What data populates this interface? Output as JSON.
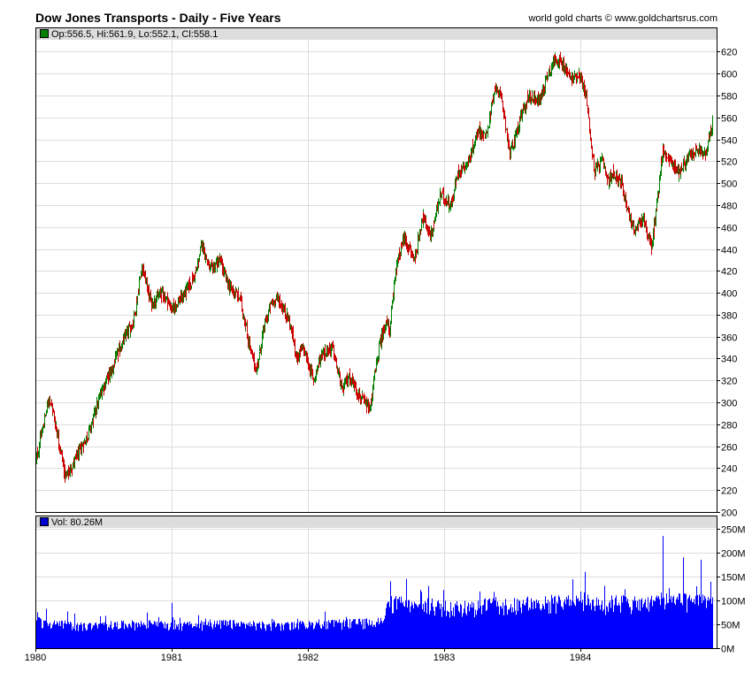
{
  "header": {
    "title": "Dow Jones Transports - Daily - Five Years",
    "credit": "world gold charts © www.goldchartsrus.com"
  },
  "price_legend": {
    "text": "Op:556.5, Hi:561.9, Lo:552.1, Cl:558.1",
    "color": "#008000"
  },
  "volume_legend": {
    "text": "Vol: 80.26M",
    "color": "#0000cc"
  },
  "colors": {
    "up": "#008000",
    "down": "#cc0000",
    "volume": "#0000ff",
    "grid": "#dcdcdc",
    "legend_bg": "#dddddd"
  },
  "chart_data": [
    {
      "type": "line",
      "title": "Dow Jones Transports - Daily - Five Years",
      "x_ticks": [
        "1980",
        "1981",
        "1982",
        "1983",
        "1984"
      ],
      "xlim": [
        1980.0,
        1985.0
      ],
      "ylim": [
        200,
        630
      ],
      "y_ticks": [
        200,
        220,
        240,
        260,
        280,
        300,
        320,
        340,
        360,
        380,
        400,
        420,
        440,
        460,
        480,
        500,
        520,
        540,
        560,
        580,
        600,
        620
      ],
      "last_bar": {
        "open": 556.5,
        "high": 561.9,
        "low": 552.1,
        "close": 558.1
      },
      "series": [
        {
          "x": [
            1980.0,
            1980.1,
            1980.13,
            1980.22,
            1980.26,
            1980.32,
            1980.4,
            1980.48,
            1980.56,
            1980.62,
            1980.72,
            1980.78,
            1980.85,
            1980.93,
            1981.0,
            1981.1,
            1981.18,
            1981.22,
            1981.28,
            1981.35,
            1981.42,
            1981.5,
            1981.58,
            1981.62,
            1981.68,
            1981.73,
            1981.78,
            1981.86,
            1981.92,
            1981.96,
            1982.04,
            1982.1,
            1982.18,
            1982.25,
            1982.3,
            1982.38,
            1982.45,
            1982.52,
            1982.57,
            1982.6,
            1982.64,
            1982.7,
            1982.78,
            1982.84,
            1982.9,
            1982.97,
            1983.05,
            1983.1,
            1983.18,
            1983.25,
            1983.3,
            1983.38,
            1983.43,
            1983.48,
            1983.56,
            1983.62,
            1983.7,
            1983.76,
            1983.82,
            1983.88,
            1983.93,
            1983.99,
            1984.04,
            1984.1,
            1984.16,
            1984.2,
            1984.24,
            1984.3,
            1984.36,
            1984.4,
            1984.46,
            1984.52,
            1984.56,
            1984.6,
            1984.66,
            1984.72,
            1984.8,
            1984.86,
            1984.92,
            1984.97
          ],
          "y": [
            245,
            305,
            290,
            232,
            240,
            255,
            275,
            310,
            330,
            350,
            375,
            425,
            390,
            400,
            385,
            400,
            420,
            445,
            420,
            430,
            405,
            395,
            345,
            330,
            370,
            390,
            395,
            375,
            340,
            350,
            320,
            345,
            350,
            310,
            325,
            305,
            292,
            350,
            375,
            365,
            420,
            450,
            430,
            470,
            450,
            490,
            480,
            510,
            520,
            550,
            540,
            590,
            570,
            525,
            560,
            580,
            575,
            600,
            615,
            605,
            595,
            600,
            580,
            510,
            520,
            500,
            510,
            500,
            470,
            455,
            470,
            440,
            480,
            530,
            520,
            510,
            525,
            530,
            525,
            558
          ]
        }
      ]
    },
    {
      "type": "bar",
      "series_name": "Vol",
      "ylim": [
        0,
        250
      ],
      "y_ticks": [
        "0M",
        "50M",
        "100M",
        "150M",
        "200M",
        "250M"
      ],
      "x_ticks": [
        "1980",
        "1981",
        "1982",
        "1983",
        "1984"
      ],
      "series": [
        {
          "name": "Vol",
          "x": [
            1980.0,
            1980.2,
            1980.4,
            1980.6,
            1980.8,
            1981.0,
            1981.2,
            1981.4,
            1981.6,
            1981.8,
            1982.0,
            1982.2,
            1982.4,
            1982.55,
            1982.6,
            1982.7,
            1982.8,
            1982.9,
            1983.0,
            1983.1,
            1983.2,
            1983.3,
            1983.4,
            1983.5,
            1983.6,
            1983.7,
            1983.8,
            1983.9,
            1984.0,
            1984.1,
            1984.2,
            1984.3,
            1984.4,
            1984.5,
            1984.6,
            1984.7,
            1984.8,
            1984.9,
            1985.0
          ],
          "values": [
            55,
            48,
            45,
            48,
            50,
            45,
            48,
            50,
            48,
            45,
            48,
            50,
            52,
            55,
            95,
            90,
            85,
            88,
            85,
            82,
            85,
            88,
            90,
            88,
            92,
            90,
            95,
            92,
            100,
            90,
            92,
            95,
            90,
            92,
            100,
            98,
            95,
            100,
            95
          ]
        }
      ],
      "spikes": [
        {
          "x": 1981.0,
          "value": 95
        },
        {
          "x": 1982.6,
          "value": 140
        },
        {
          "x": 1982.72,
          "value": 145
        },
        {
          "x": 1982.88,
          "value": 130
        },
        {
          "x": 1984.03,
          "value": 160
        },
        {
          "x": 1984.6,
          "value": 235
        },
        {
          "x": 1984.75,
          "value": 190
        },
        {
          "x": 1984.88,
          "value": 185
        },
        {
          "x": 1984.97,
          "value": 150
        }
      ],
      "last_value": 80.26
    }
  ]
}
